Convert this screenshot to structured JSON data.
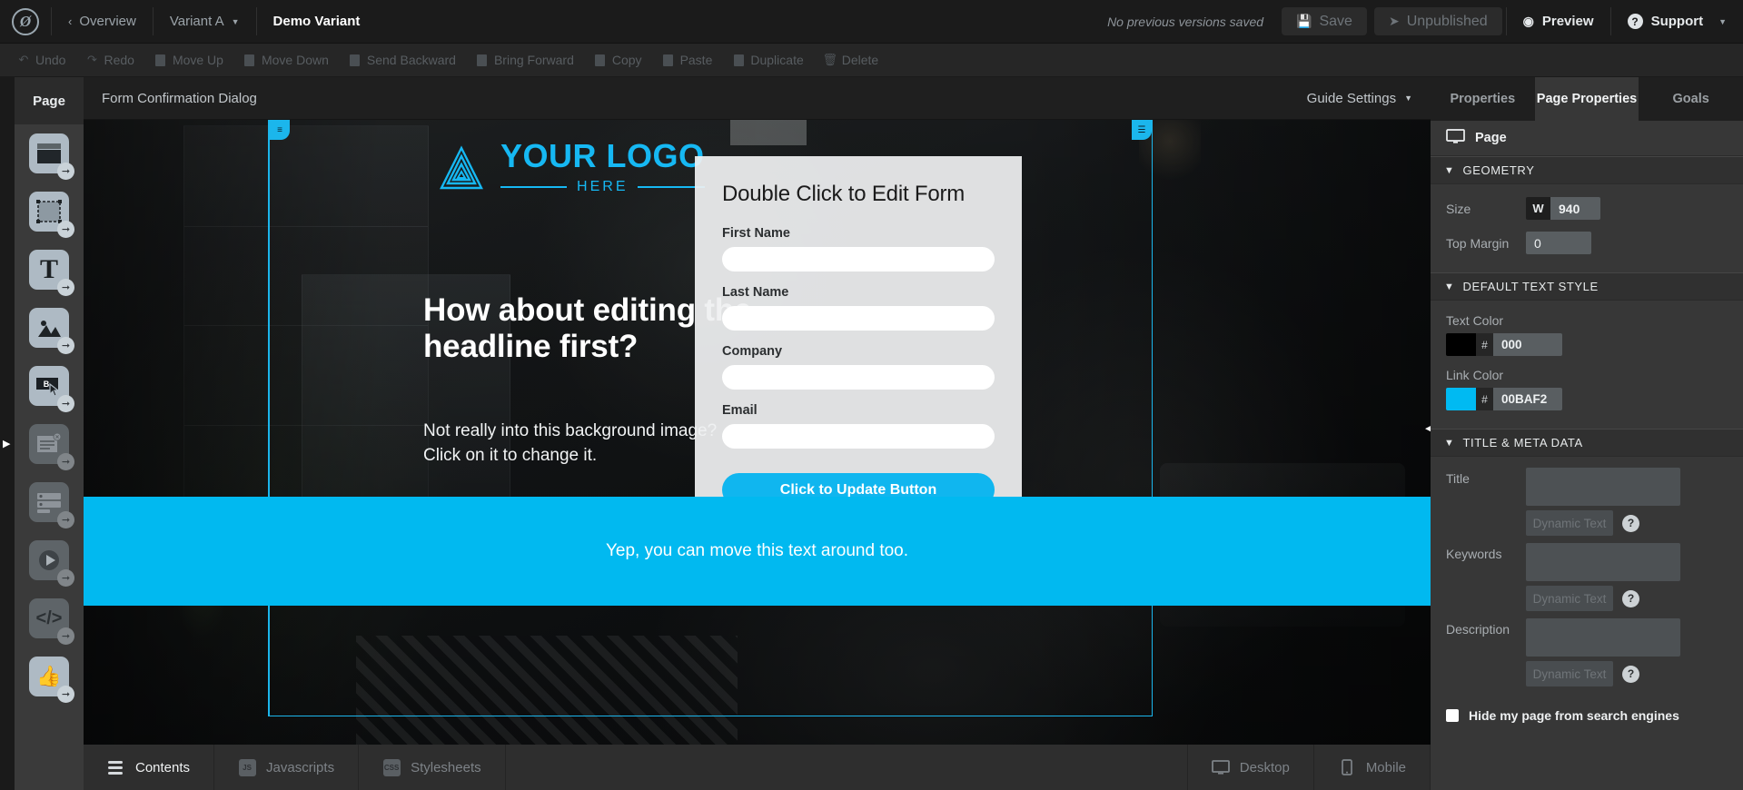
{
  "topbar": {
    "app_logo": "unbounce-logo-icon",
    "overview": "Overview",
    "variant": "Variant  A",
    "page_name": "Demo Variant",
    "save_note": "No previous versions saved",
    "save": "Save",
    "unpublished": "Unpublished",
    "preview": "Preview",
    "support": "Support"
  },
  "actionbar": {
    "items": [
      {
        "label": "Undo",
        "icon": "undo-arrow-icon"
      },
      {
        "label": "Redo",
        "icon": "redo-arrow-icon"
      },
      {
        "label": "Move Up",
        "icon": "arrow-up-icon"
      },
      {
        "label": "Move Down",
        "icon": "arrow-down-icon"
      },
      {
        "label": "Send Backward",
        "icon": "send-backward-icon"
      },
      {
        "label": "Bring Forward",
        "icon": "bring-forward-icon"
      },
      {
        "label": "Copy",
        "icon": "copy-icon"
      },
      {
        "label": "Paste",
        "icon": "paste-icon"
      },
      {
        "label": "Duplicate",
        "icon": "duplicate-icon"
      },
      {
        "label": "Delete",
        "icon": "trash-icon"
      }
    ]
  },
  "toolbar": {
    "page_tab": "Page",
    "tools": [
      {
        "name": "section-tool",
        "icon": "section-icon"
      },
      {
        "name": "box-tool",
        "icon": "marquee-box-icon"
      },
      {
        "name": "text-tool",
        "icon": "text-t-icon"
      },
      {
        "name": "image-tool",
        "icon": "image-mountain-icon"
      },
      {
        "name": "button-tool",
        "icon": "button-cursor-icon"
      },
      {
        "name": "popup-tool",
        "icon": "popup-window-icon"
      },
      {
        "name": "form-tool",
        "icon": "form-rows-icon"
      },
      {
        "name": "video-tool",
        "icon": "play-circle-icon"
      },
      {
        "name": "code-tool",
        "icon": "code-brackets-icon"
      },
      {
        "name": "social-tool",
        "icon": "thumbs-up-icon"
      }
    ]
  },
  "canvas_header": {
    "title": "Form Confirmation Dialog",
    "guide_settings": "Guide Settings"
  },
  "page_content": {
    "brand_main": "YOUR LOGO",
    "brand_sub": "HERE",
    "headline": "How about editing the headline first?",
    "subcopy": "Not really into this background image? Click on it to change it.",
    "band_text": "Yep, you can move this text around too.",
    "form": {
      "title": "Double Click to Edit Form",
      "fields": [
        {
          "label": "First Name",
          "value": ""
        },
        {
          "label": "Last Name",
          "value": ""
        },
        {
          "label": "Company",
          "value": ""
        },
        {
          "label": "Email",
          "value": ""
        }
      ],
      "submit": "Click to Update Button"
    }
  },
  "bottombar": {
    "tabs": [
      {
        "label": "Contents",
        "icon": "list-lines-icon",
        "active": true
      },
      {
        "label": "Javascripts",
        "icon": "js-badge-icon",
        "active": false
      },
      {
        "label": "Stylesheets",
        "icon": "css-badge-icon",
        "active": false
      }
    ],
    "views": [
      {
        "label": "Desktop",
        "icon": "monitor-icon"
      },
      {
        "label": "Mobile",
        "icon": "phone-icon"
      }
    ]
  },
  "rightpanel": {
    "tabs": [
      {
        "label": "Properties",
        "active": false
      },
      {
        "label": "Page Properties",
        "active": true
      },
      {
        "label": "Goals",
        "active": false
      }
    ],
    "header": "Page",
    "header_icon": "monitor-icon",
    "geometry": {
      "section": "GEOMETRY",
      "size_label": "Size",
      "width_tag": "W",
      "width_value": "940",
      "top_margin_label": "Top Margin",
      "top_margin_value": "0"
    },
    "text_style": {
      "section": "DEFAULT TEXT STYLE",
      "text_color_label": "Text Color",
      "text_color_hash": "#",
      "text_color_value": "000",
      "text_color_swatch": "#000000",
      "link_color_label": "Link Color",
      "link_color_hash": "#",
      "link_color_value": "00BAF2",
      "link_color_swatch": "#00BAF2"
    },
    "meta": {
      "section": "TITLE & META DATA",
      "title_label": "Title",
      "title_value": "",
      "keywords_label": "Keywords",
      "keywords_value": "",
      "description_label": "Description",
      "description_value": "",
      "dynamic_text": "Dynamic Text",
      "help": "?",
      "hide_label": "Hide my page from search engines"
    }
  },
  "colors": {
    "accent": "#00BAF2",
    "panel_bg": "#373737",
    "topbar_bg": "#1B1B1B"
  }
}
